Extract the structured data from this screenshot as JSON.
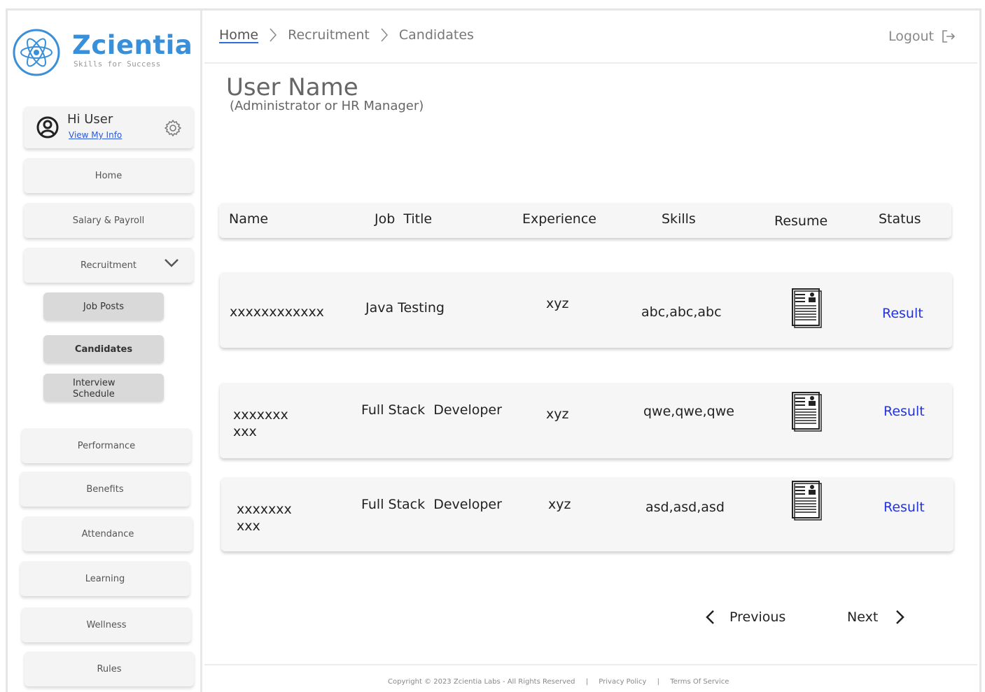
{
  "brand": {
    "name": "Zcientia",
    "tagline": "Skills for Success",
    "color": "#3a8fd9"
  },
  "user": {
    "greeting": "Hi User",
    "link": "View My Info"
  },
  "nav": {
    "home": "Home",
    "salary": "Salary & Payroll",
    "recruitment": "Recruitment",
    "job_posts": "Job Posts",
    "candidates": "Candidates",
    "interview": "Interview Schedule",
    "performance": "Performance",
    "benefits": "Benefits",
    "attendance": "Attendance",
    "learning": "Learning",
    "wellness": "Wellness",
    "rules": "Rules"
  },
  "breadcrumb": {
    "home": "Home",
    "recruitment": "Recruitment",
    "candidates": "Candidates"
  },
  "logout": "Logout",
  "page": {
    "title": "User Name",
    "subtitle": "(Administrator or HR Manager)"
  },
  "table": {
    "columns": {
      "name": "Name",
      "job_title": "Job  Title",
      "experience": "Experience",
      "skills": "Skills",
      "resume": "Resume",
      "status": "Status"
    },
    "rows": [
      {
        "name": "xxxxxxxxxxxx",
        "job_title": "Java Testing",
        "experience": "xyz",
        "skills": "abc,abc,abc",
        "status": "Result"
      },
      {
        "name_line1": "xxxxxxx",
        "name_line2": "xxx",
        "job_title": "Full Stack  Developer",
        "experience": "xyz",
        "skills": "qwe,qwe,qwe",
        "status": "Result"
      },
      {
        "name_line1": "xxxxxxx",
        "name_line2": "xxx",
        "job_title": "Full Stack  Developer",
        "experience": "xyz",
        "skills": "asd,asd,asd",
        "status": "Result"
      }
    ]
  },
  "pagination": {
    "previous": "Previous",
    "next": "Next"
  },
  "footer": {
    "copyright": "Copyright © 2023 Zcientia Labs - All Rights Reserved",
    "privacy": "Privacy Policy",
    "terms": "Terms Of Service",
    "sep": "|"
  },
  "colors": {
    "link": "#2233dd",
    "card": "#f6f6f6",
    "submenu": "#d9d9d9"
  }
}
